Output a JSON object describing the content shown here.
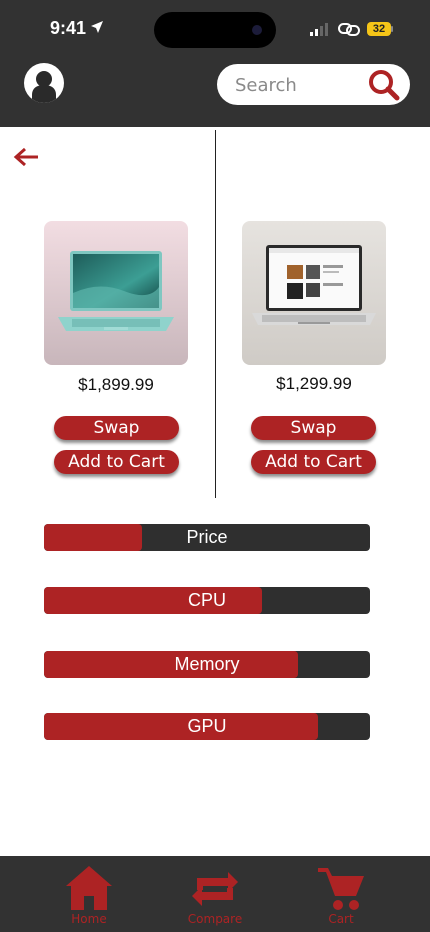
{
  "status_bar": {
    "time": "9:41",
    "battery": "32"
  },
  "header": {
    "search": {
      "placeholder": "Search"
    }
  },
  "compare": {
    "products": [
      {
        "price": "$1,899.99",
        "swap_label": "Swap",
        "add_to_cart_label": "Add to Cart",
        "image": "laptop-teal-image"
      },
      {
        "price": "$1,299.99",
        "swap_label": "Swap",
        "add_to_cart_label": "Add to Cart",
        "image": "laptop-silver-image"
      }
    ],
    "metrics": [
      {
        "label": "Price",
        "level": 0.3
      },
      {
        "label": "CPU",
        "level": 0.67
      },
      {
        "label": "Memory",
        "level": 0.78
      },
      {
        "label": "GPU",
        "level": 0.84
      }
    ]
  },
  "nav": {
    "items": [
      {
        "label": "Home",
        "icon": "home-icon"
      },
      {
        "label": "Compare",
        "icon": "compare-icon"
      },
      {
        "label": "Cart",
        "icon": "cart-icon"
      }
    ]
  },
  "colors": {
    "accent": "#ad2324",
    "header": "#323232",
    "bar_track": "#2f2f2f"
  }
}
